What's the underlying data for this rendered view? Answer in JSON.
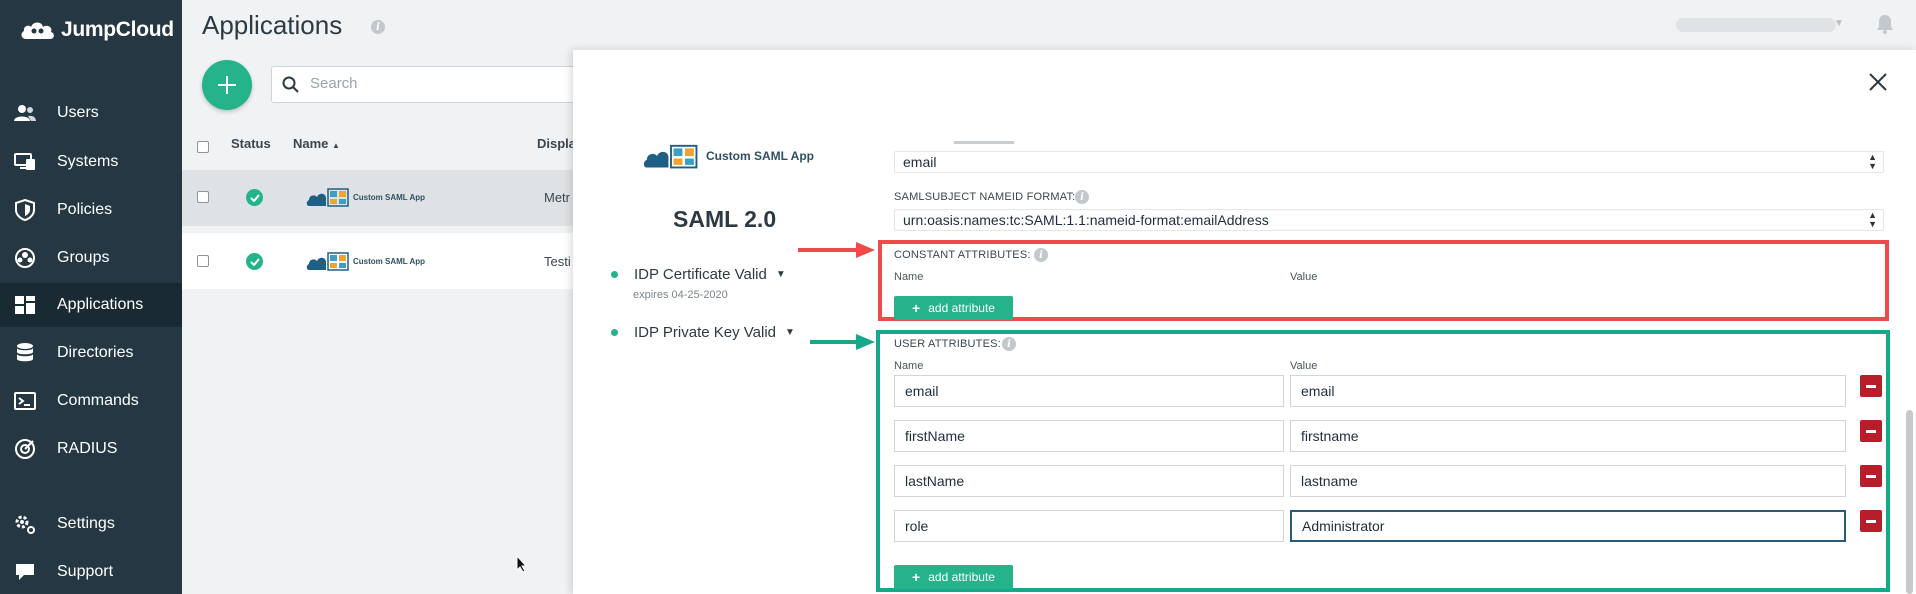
{
  "brand": {
    "name": "JumpCloud"
  },
  "sidebar": {
    "items": [
      {
        "label": "Users",
        "icon": "users-icon"
      },
      {
        "label": "Systems",
        "icon": "systems-icon"
      },
      {
        "label": "Policies",
        "icon": "policies-icon"
      },
      {
        "label": "Groups",
        "icon": "groups-icon"
      },
      {
        "label": "Applications",
        "icon": "applications-icon",
        "active": true
      },
      {
        "label": "Directories",
        "icon": "directories-icon"
      },
      {
        "label": "Commands",
        "icon": "commands-icon"
      },
      {
        "label": "RADIUS",
        "icon": "radius-icon"
      },
      {
        "label": "Settings",
        "icon": "settings-icon"
      },
      {
        "label": "Support",
        "icon": "support-icon"
      }
    ]
  },
  "header": {
    "title": "Applications"
  },
  "search": {
    "placeholder": "Search"
  },
  "table": {
    "columns": {
      "status": "Status",
      "name": "Name",
      "display": "Displa"
    },
    "rows": [
      {
        "app_logo_text": "Custom SAML App",
        "display": "Metr",
        "selected": true
      },
      {
        "app_logo_text": "Custom SAML App",
        "display": "Testi",
        "selected": false
      }
    ]
  },
  "panel": {
    "app_logo_text": "Custom SAML App",
    "saml_title": "SAML 2.0",
    "idp_certificate": {
      "label": "IDP Certificate Valid",
      "expires": "expires 04-25-2020"
    },
    "idp_private_key": {
      "label": "IDP Private Key Valid"
    },
    "email_select": {
      "value": "email"
    },
    "nameid_format": {
      "label": "SAMLSUBJECT NAMEID FORMAT:",
      "value": "urn:oasis:names:tc:SAML:1.1:nameid-format:emailAddress"
    },
    "constant_attributes": {
      "label": "CONSTANT ATTRIBUTES:",
      "name_header": "Name",
      "value_header": "Value",
      "add_label": "add attribute"
    },
    "user_attributes": {
      "label": "USER ATTRIBUTES:",
      "name_header": "Name",
      "value_header": "Value",
      "add_label": "add attribute",
      "rows": [
        {
          "name": "email",
          "value": "email"
        },
        {
          "name": "firstName",
          "value": "firstname"
        },
        {
          "name": "lastName",
          "value": "lastname"
        },
        {
          "name": "role",
          "value": "Administrator"
        }
      ]
    }
  },
  "colors": {
    "sidebar_bg": "#243742",
    "accent_green": "#24b38b",
    "highlight_red": "#ee4a4a",
    "highlight_teal": "#16a88b",
    "remove_red": "#b81e2a"
  }
}
